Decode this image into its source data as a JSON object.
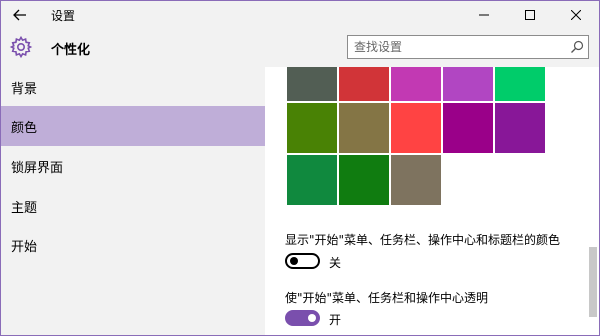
{
  "window": {
    "title": "设置",
    "back_icon": "arrow-left-icon",
    "minimize_icon": "minimize-icon",
    "maximize_icon": "maximize-icon",
    "close_icon": "close-icon"
  },
  "header": {
    "icon": "gear-icon",
    "title": "个性化",
    "search": {
      "placeholder": "查找设置",
      "value": "",
      "icon": "search-icon"
    }
  },
  "sidebar": {
    "items": [
      {
        "label": "背景",
        "active": false
      },
      {
        "label": "颜色",
        "active": true
      },
      {
        "label": "锁屏界面",
        "active": false
      },
      {
        "label": "主题",
        "active": false
      },
      {
        "label": "开始",
        "active": false
      }
    ],
    "active_color": "#bfaed8"
  },
  "main": {
    "color_swatches": [
      "#525e54",
      "#d13438",
      "#c239b3",
      "#b146c2",
      "#00cc6a",
      "#498205",
      "#847545",
      "#ff4343",
      "#9a0089",
      "#881798",
      "#10893e",
      "#107c10",
      "#7e735f"
    ],
    "show_color_setting": {
      "label": "显示\"开始\"菜单、任务栏、操作中心和标题栏的颜色",
      "state_text": "关",
      "on": false
    },
    "transparency_setting": {
      "label": "使\"开始\"菜单、任务栏和操作中心透明",
      "state_text": "开",
      "on": true
    },
    "accent_color": "#7a4fad"
  }
}
